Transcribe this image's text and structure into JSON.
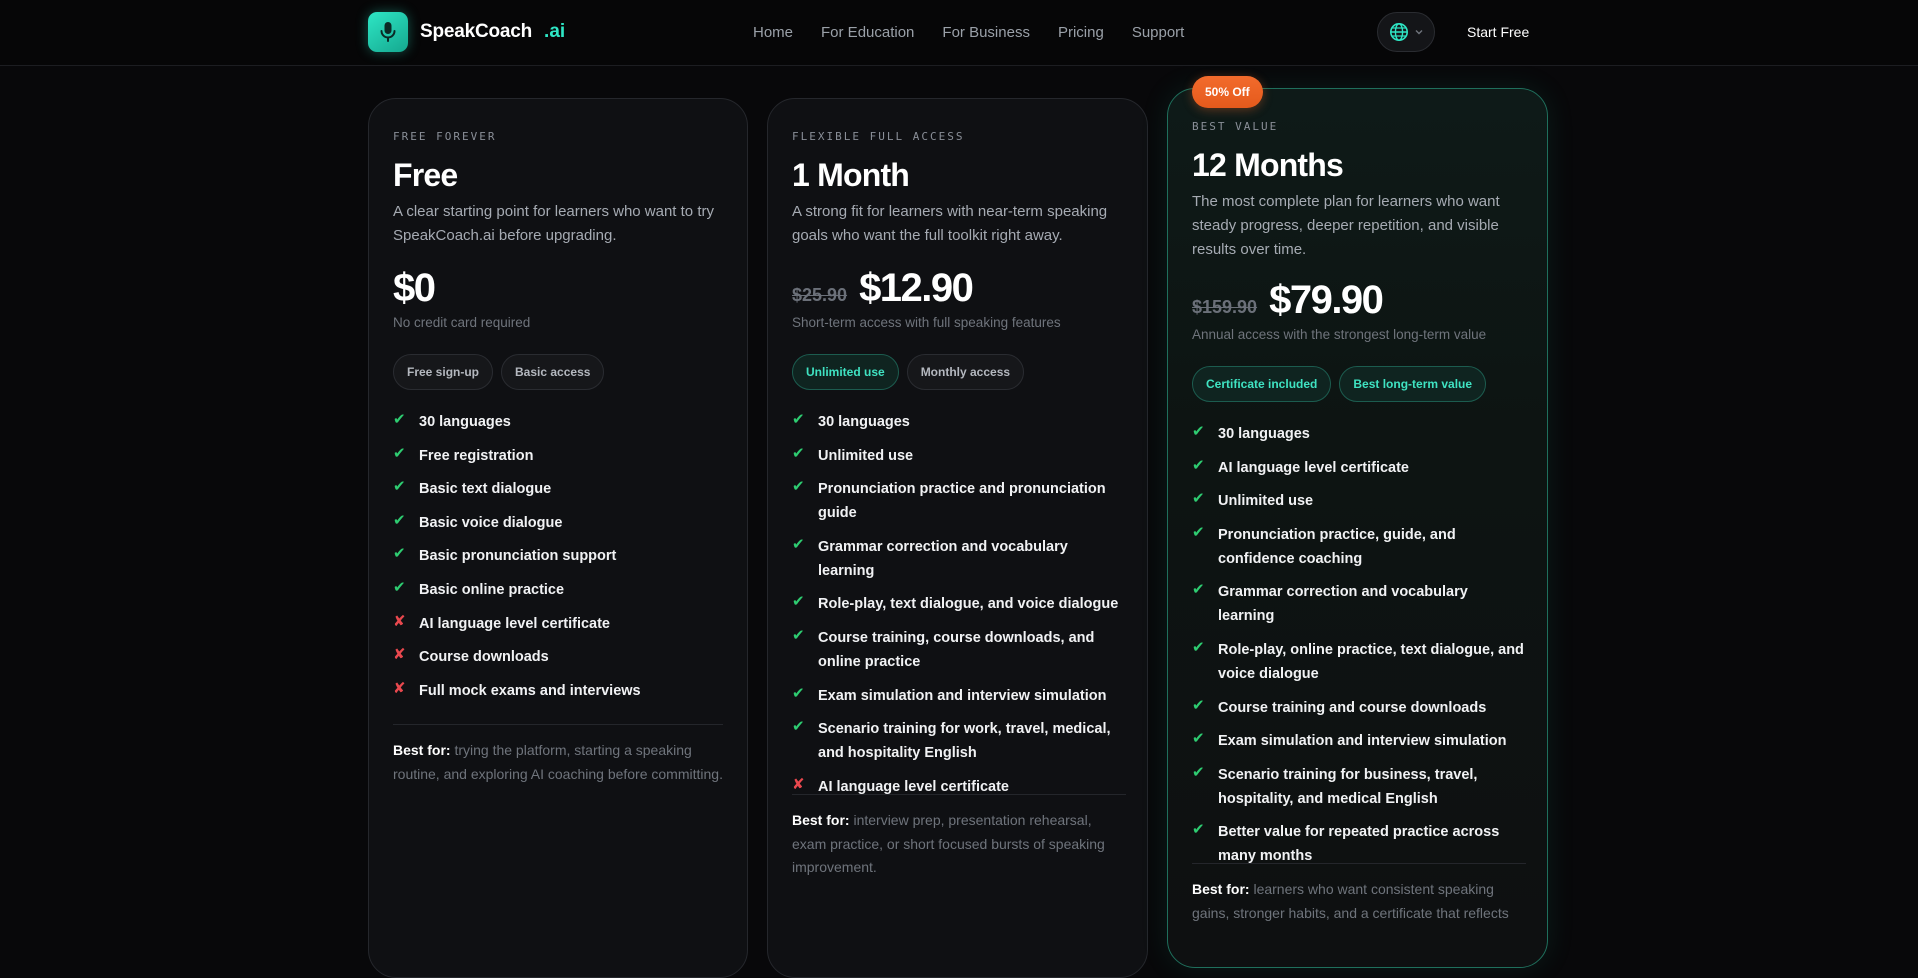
{
  "nav": {
    "brand_name": "SpeakCoach",
    "brand_suffix": ".ai",
    "links": [
      "Home",
      "For Education",
      "For Business",
      "Pricing",
      "Support"
    ],
    "cta": "Start Free"
  },
  "colors": {
    "accent": "#2ee6c5",
    "check": "#2ecc71",
    "cross": "#e8484e",
    "badge": "#f26b2c"
  },
  "plans": [
    {
      "eyebrow": "FREE FOREVER",
      "name": "Free",
      "desc": "A clear starting point for learners who want to try SpeakCoach.ai before upgrading.",
      "price_old": "",
      "price": "$0",
      "price_note": "No credit card required",
      "pills": [
        "Free sign-up",
        "Basic access"
      ],
      "features": [
        {
          "text": "30 languages",
          "included": true
        },
        {
          "text": "Free registration",
          "included": true
        },
        {
          "text": "Basic text dialogue",
          "included": true
        },
        {
          "text": "Basic voice dialogue",
          "included": true
        },
        {
          "text": "Basic pronunciation support",
          "included": true
        },
        {
          "text": "Basic online practice",
          "included": true
        },
        {
          "text": "AI language level certificate",
          "included": false
        },
        {
          "text": "Course downloads",
          "included": false
        },
        {
          "text": "Full mock exams and interviews",
          "included": false
        }
      ],
      "best_for_label": "Best for:",
      "best_for": "trying the platform, starting a speaking routine, and exploring AI coaching before committing."
    },
    {
      "eyebrow": "FLEXIBLE FULL ACCESS",
      "name": "1 Month",
      "desc": "A strong fit for learners with near-term speaking goals who want the full toolkit right away.",
      "price_old": "$25.90",
      "price": "$12.90",
      "price_note": "Short-term access with full speaking features",
      "pills": [
        "Unlimited use",
        "Monthly access"
      ],
      "features": [
        {
          "text": "30 languages",
          "included": true
        },
        {
          "text": "Unlimited use",
          "included": true
        },
        {
          "text": "Pronunciation practice and pronunciation guide",
          "included": true
        },
        {
          "text": "Grammar correction and vocabulary learning",
          "included": true
        },
        {
          "text": "Role-play, text dialogue, and voice dialogue",
          "included": true
        },
        {
          "text": "Course training, course downloads, and online practice",
          "included": true
        },
        {
          "text": "Exam simulation and interview simulation",
          "included": true
        },
        {
          "text": "Scenario training for work, travel, medical, and hospitality English",
          "included": true
        },
        {
          "text": "AI language level certificate",
          "included": false
        }
      ],
      "best_for_label": "Best for:",
      "best_for": "interview prep, presentation rehearsal, exam practice, or short focused bursts of speaking improvement."
    },
    {
      "badge": "50% Off",
      "eyebrow": "BEST VALUE",
      "name": "12 Months",
      "desc": "The most complete plan for learners who want steady progress, deeper repetition, and visible results over time.",
      "price_old": "$159.90",
      "price": "$79.90",
      "price_note": "Annual access with the strongest long-term value",
      "pills": [
        "Certificate included",
        "Best long-term value"
      ],
      "features": [
        {
          "text": "30 languages",
          "included": true
        },
        {
          "text": "AI language level certificate",
          "included": true
        },
        {
          "text": "Unlimited use",
          "included": true
        },
        {
          "text": "Pronunciation practice, guide, and confidence coaching",
          "included": true
        },
        {
          "text": "Grammar correction and vocabulary learning",
          "included": true
        },
        {
          "text": "Role-play, online practice, text dialogue, and voice dialogue",
          "included": true
        },
        {
          "text": "Course training and course downloads",
          "included": true
        },
        {
          "text": "Exam simulation and interview simulation",
          "included": true
        },
        {
          "text": "Scenario training for business, travel, hospitality, and medical English",
          "included": true
        },
        {
          "text": "Better value for repeated practice across many months",
          "included": true
        }
      ],
      "best_for_label": "Best for:",
      "best_for": "learners who want consistent speaking gains, stronger habits, and a certificate that reflects"
    }
  ]
}
